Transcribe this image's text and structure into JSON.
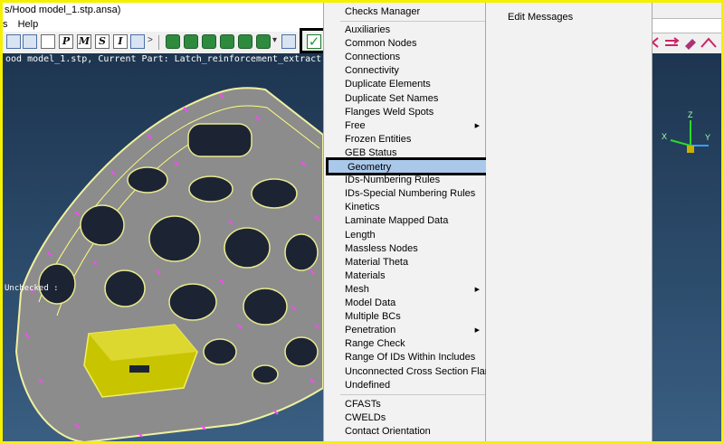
{
  "window": {
    "title": "s/Hood model_1.stp.ansa)"
  },
  "menubar": {
    "items": [
      "s",
      "Help"
    ]
  },
  "toolbar": {
    "buttons": [
      "P",
      "M",
      "S",
      "I"
    ],
    "more": ">"
  },
  "viewport": {
    "status_line": "ood model_1.stp,  Current Part: Latch_reinforcement_extract",
    "unchecked_label": "Unchecked :",
    "axis_labels": {
      "x": "X",
      "y": "Y",
      "z": "Z"
    }
  },
  "checks_menu": {
    "header": "Checks Manager",
    "items": [
      {
        "label": "Auxiliaries"
      },
      {
        "label": "Common Nodes"
      },
      {
        "label": "Connections"
      },
      {
        "label": "Connectivity"
      },
      {
        "label": "Duplicate Elements"
      },
      {
        "label": "Duplicate Set Names"
      },
      {
        "label": "Flanges Weld Spots"
      },
      {
        "label": "Free",
        "submenu": true
      },
      {
        "label": "Frozen Entities"
      },
      {
        "label": "GEB Status"
      },
      {
        "label": "Geometry",
        "highlighted": true
      },
      {
        "label": "IDs-Numbering Rules"
      },
      {
        "label": "IDs-Special Numbering Rules"
      },
      {
        "label": "Kinetics"
      },
      {
        "label": "Laminate Mapped Data"
      },
      {
        "label": "Length"
      },
      {
        "label": "Massless Nodes"
      },
      {
        "label": "Material Theta"
      },
      {
        "label": "Materials"
      },
      {
        "label": "Mesh",
        "submenu": true
      },
      {
        "label": "Model Data"
      },
      {
        "label": "Multiple BCs"
      },
      {
        "label": "Penetration",
        "submenu": true
      },
      {
        "label": "Range Check"
      },
      {
        "label": "Range Of IDs Within Includes"
      },
      {
        "label": "Unconnected Cross Section Flanges"
      },
      {
        "label": "Undefined"
      }
    ],
    "items2": [
      {
        "label": "CFASTs"
      },
      {
        "label": "CWELDs"
      },
      {
        "label": "Contact Orientation"
      }
    ]
  },
  "side_menu": {
    "item": "Edit Messages"
  },
  "colors": {
    "highlight": "#a9c8ea",
    "frame": "#f4f000",
    "mesh": "#ff44ff",
    "part": "#c8c400"
  }
}
